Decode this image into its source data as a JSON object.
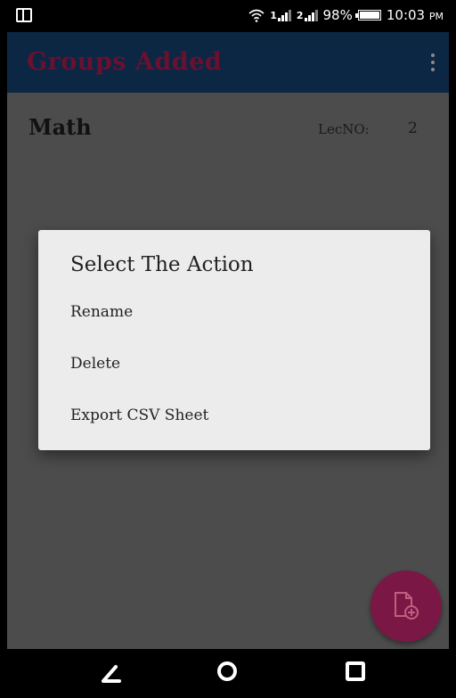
{
  "status_bar": {
    "sim1": "1",
    "sim2": "2",
    "battery": "98%",
    "time": "10:03",
    "ampm": "PM"
  },
  "app_bar": {
    "title": "Groups Added"
  },
  "groups": [
    {
      "name": "Math",
      "lec_label": "LecNO:",
      "lec_value": "2"
    }
  ],
  "dialog": {
    "title": "Select The Action",
    "items": [
      "Rename",
      "Delete",
      "Export CSV Sheet"
    ]
  },
  "colors": {
    "app_bar": "#0b2744",
    "accent": "#7a1745",
    "dialog_bg": "#ececec"
  }
}
